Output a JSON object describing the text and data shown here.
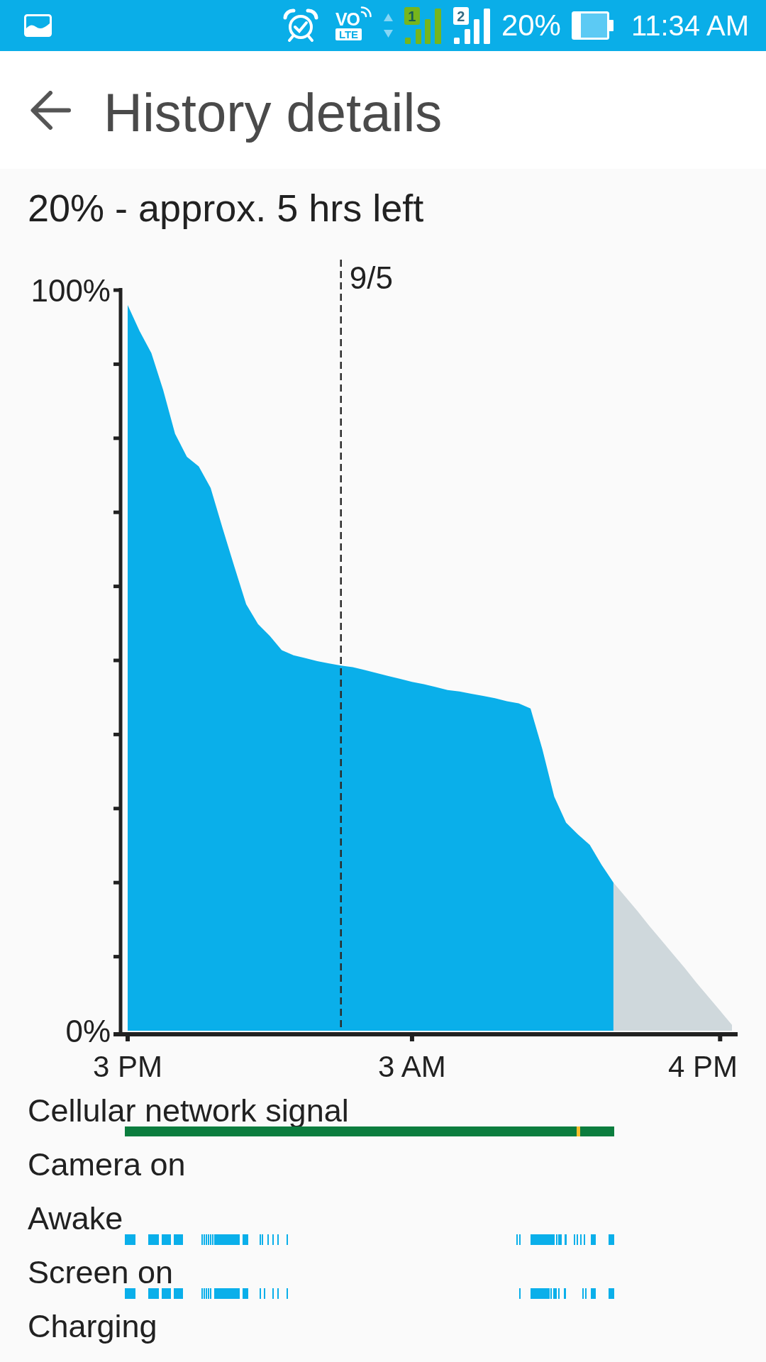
{
  "status_bar": {
    "volte": {
      "top": "VO",
      "bottom": "LTE"
    },
    "sim_signals": [
      {
        "badge": "1",
        "color": "#76b51c"
      },
      {
        "badge": "2",
        "color": "#ffffff"
      }
    ],
    "battery_percent": "20%",
    "time": "11:34 AM"
  },
  "app_bar": {
    "title": "History details"
  },
  "summary": "20% - approx. 5 hrs left",
  "battery_chart": {
    "date_label": "9/5",
    "chart_data": {
      "type": "area",
      "categories": [
        "3 PM",
        null,
        null,
        null,
        null,
        null,
        null,
        null,
        null,
        null,
        null,
        null,
        null,
        null,
        null,
        null,
        null,
        null,
        null,
        null,
        null,
        null,
        null,
        null,
        "3 AM",
        null,
        null,
        null,
        null,
        null,
        null,
        null,
        null,
        null,
        null,
        null,
        null,
        null,
        null,
        null,
        null,
        null,
        null,
        null,
        null,
        null,
        null,
        null,
        null,
        null,
        "4 PM",
        null
      ],
      "series": [
        {
          "color": "#0aafea",
          "values": [
            98,
            94.5,
            91.5,
            86.5,
            80.6,
            77.5,
            76.2,
            73.3,
            67.9,
            62.7,
            57.6,
            54.9,
            53.3,
            51.4,
            50.7,
            50.3,
            49.9,
            49.6,
            49.3,
            49.1,
            48.7,
            48.3,
            47.9,
            47.5,
            47.1,
            46.8,
            46.4,
            46.0,
            45.8,
            45.5,
            45.2,
            44.9,
            44.5,
            44.2,
            43.5,
            38.0,
            31.6,
            28.1,
            26.5,
            25.1,
            22.4,
            20,
            null,
            null,
            null,
            null,
            null,
            null,
            null,
            null,
            null,
            null
          ]
        },
        {
          "color": "#cfd8dc",
          "values": [
            null,
            null,
            null,
            null,
            null,
            null,
            null,
            null,
            null,
            null,
            null,
            null,
            null,
            null,
            null,
            null,
            null,
            null,
            null,
            null,
            null,
            null,
            null,
            null,
            null,
            null,
            null,
            null,
            null,
            null,
            null,
            null,
            null,
            null,
            null,
            null,
            null,
            null,
            null,
            null,
            null,
            20,
            18.1,
            16.2,
            14.2,
            12.3,
            10.4,
            8.5,
            6.5,
            4.6,
            2.7,
            0.8
          ]
        }
      ],
      "ylim": [
        0,
        100
      ],
      "yticks": [
        {
          "value": 0,
          "label": "0%"
        },
        {
          "value": 100,
          "label": "100%"
        }
      ]
    }
  },
  "timelines": [
    {
      "label": "Cellular network signal",
      "kind": "signal"
    },
    {
      "label": "Camera on",
      "kind": "empty"
    },
    {
      "label": "Awake",
      "kind": "activity"
    },
    {
      "label": "Screen on",
      "kind": "activity"
    },
    {
      "label": "Charging",
      "kind": "empty"
    }
  ]
}
